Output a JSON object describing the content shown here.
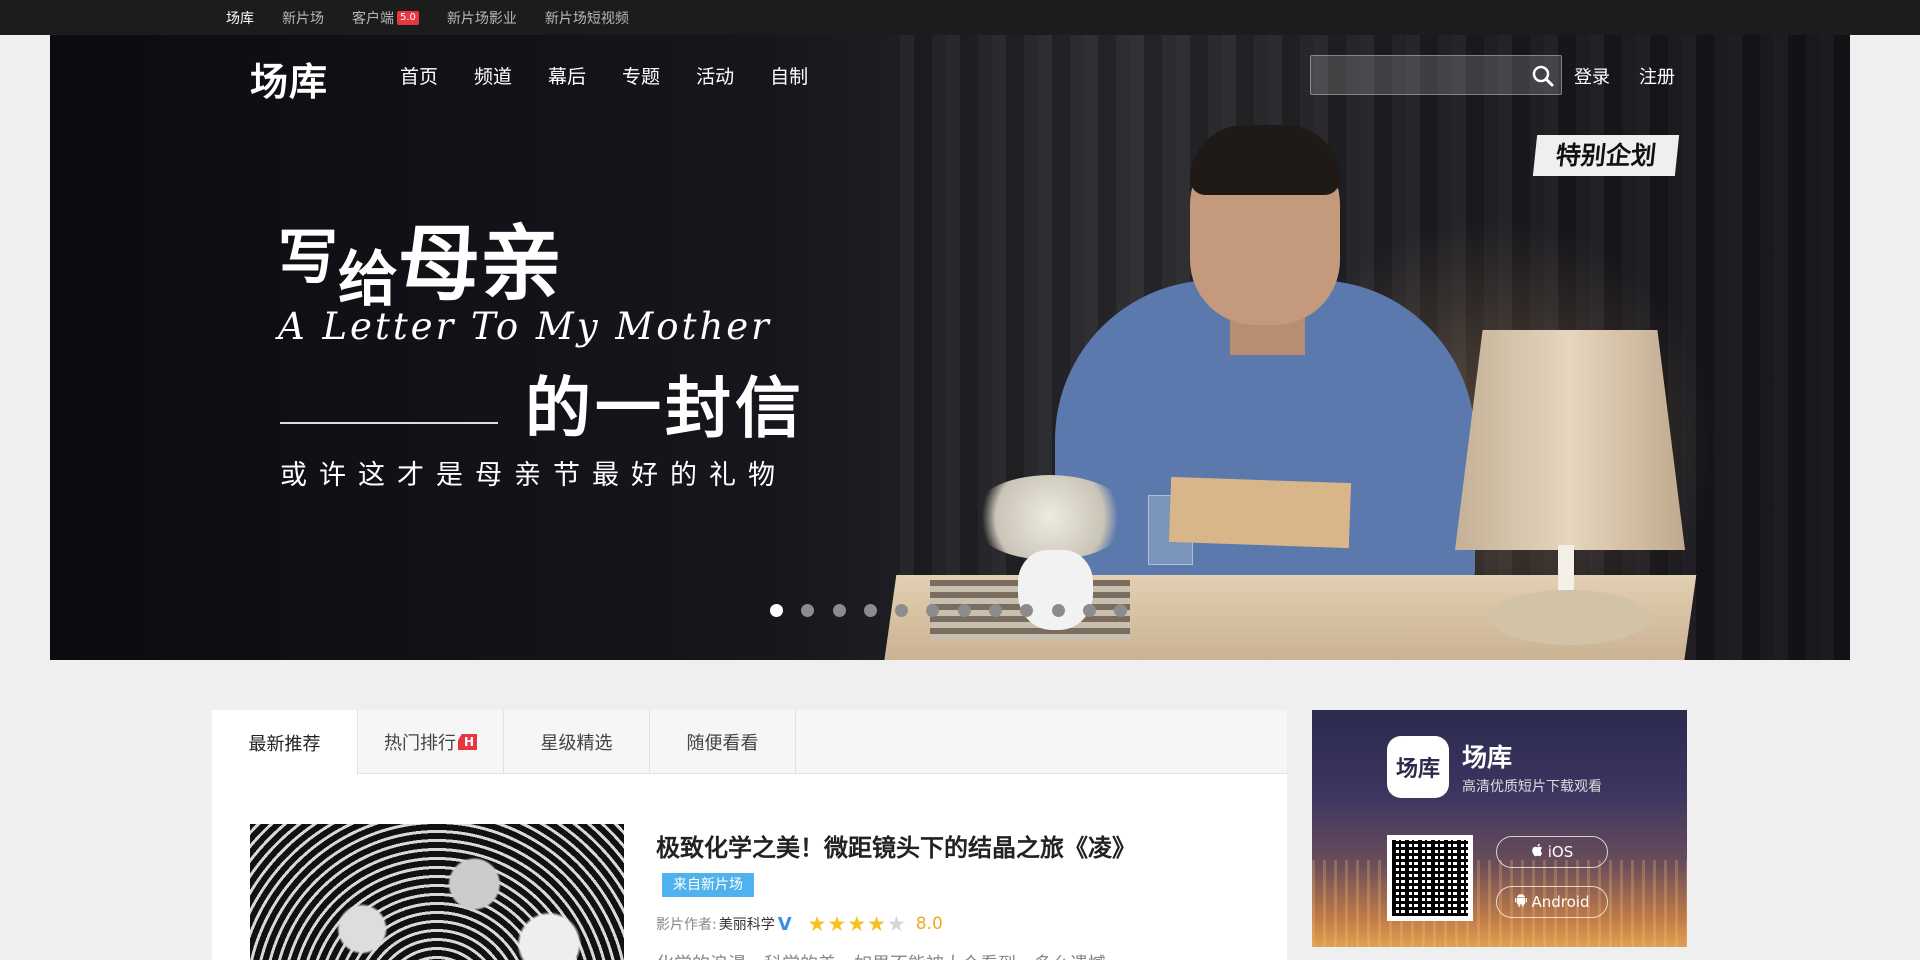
{
  "topbar": {
    "links": [
      {
        "label": "场库"
      },
      {
        "label": "新片场"
      },
      {
        "label": "客户端",
        "badge": "5.0"
      },
      {
        "label": "新片场影业"
      },
      {
        "label": "新片场短视频"
      }
    ]
  },
  "header": {
    "logo": "场库",
    "menu": [
      "首页",
      "频道",
      "幕后",
      "专题",
      "活动",
      "自制"
    ],
    "search": {
      "placeholder": "",
      "value": ""
    },
    "login": "登录",
    "register": "注册"
  },
  "hero": {
    "tag": "特别企划",
    "title_part1": "写",
    "title_part2": "给",
    "title_part3": "母亲",
    "title_en": "A Letter To My Mother",
    "title_part4": "的一封信",
    "subtitle": "或许这才是母亲节最好的礼物",
    "dots_total": 12,
    "dots_active_index": 0
  },
  "main": {
    "tabs": [
      {
        "label": "最新推荐",
        "active": true
      },
      {
        "label": "热门排行",
        "badge": "H"
      },
      {
        "label": "星级精选"
      },
      {
        "label": "随便看看"
      }
    ],
    "video": {
      "title": "极致化学之美！微距镜头下的结晶之旅《凌》",
      "source": "来自新片场",
      "author_label": "影片作者:",
      "author": "美丽科学",
      "verified_mark": "V",
      "rating_stars": 4,
      "rating_max": 5,
      "rating": "8.0",
      "description": "化学的浪漫，科学的美，如果不能被大众看到，多么遗憾"
    }
  },
  "ad": {
    "logo_text": "场库",
    "name": "场库",
    "description": "高清优质短片下载观看",
    "ios_label": "iOS",
    "android_label": "Android"
  },
  "colors": {
    "accent": "#4fb2ee",
    "badge_red": "#e6363f",
    "star": "#f5c120",
    "rating": "#f5a623"
  }
}
